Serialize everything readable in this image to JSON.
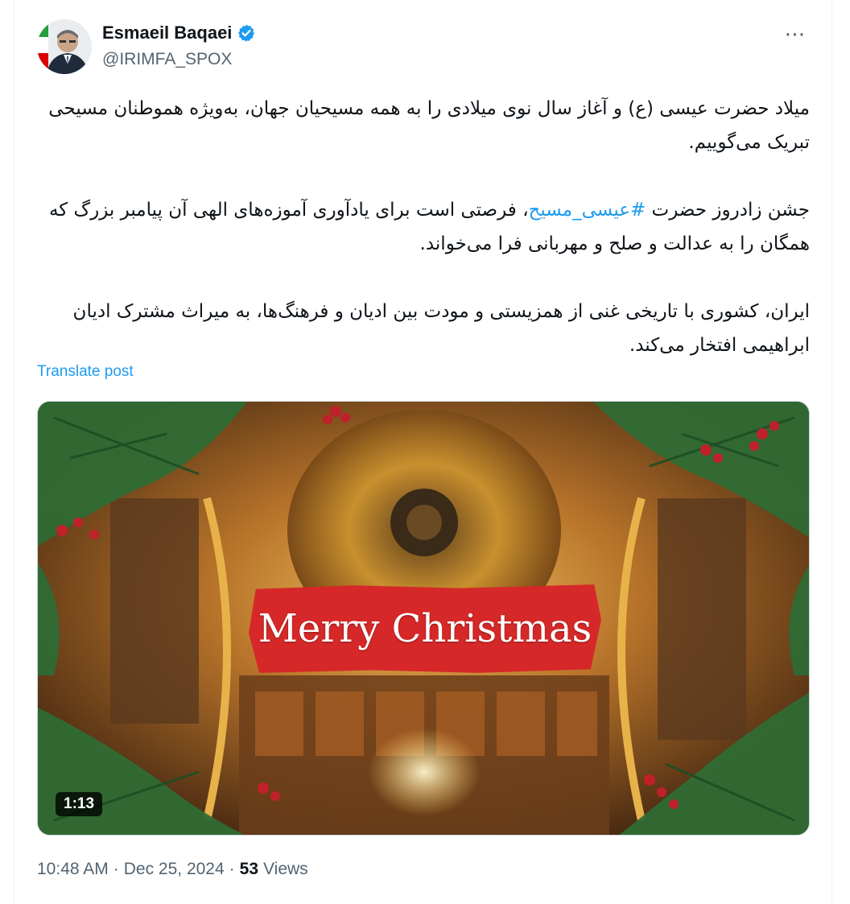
{
  "author": {
    "name": "Esmaeil Baqaei",
    "handle": "@IRIMFA_SPOX",
    "verified": true
  },
  "more_icon": "⋯",
  "post": {
    "paragraphs": [
      {
        "text": "میلاد حضرت عیسی (ع) و آغاز سال نوی میلادی را به همه مسیحیان جهان، به‌ویژه هموطنان مسیحی تبریک می‌گوییم."
      },
      {
        "before": "جشن زادروز حضرت ",
        "hashtag": "#عیسی_مسیح",
        "after": "، فرصتی است برای یادآوری آموزه‌های الهی آن پیامبر بزرگ که همگان را به عدالت و صلح و مهربانی فرا می‌خواند."
      },
      {
        "text": "ایران، کشوری با تاریخی غنی از همزیستی و مودت بین ادیان و فرهنگ‌ها، به میراث مشترک ادیان ابراهیمی افتخار می‌کند."
      }
    ],
    "translate_label": "Translate post"
  },
  "media": {
    "banner_text": "Merry Christmas",
    "duration": "1:13"
  },
  "meta": {
    "time": "10:48 AM",
    "separator": "·",
    "date": "Dec 25, 2024",
    "views_count": "53",
    "views_label": "Views"
  },
  "colors": {
    "link": "#1d9bf0",
    "secondary_text": "#536471",
    "banner_red": "#d62828",
    "verified_blue": "#1d9bf0"
  }
}
